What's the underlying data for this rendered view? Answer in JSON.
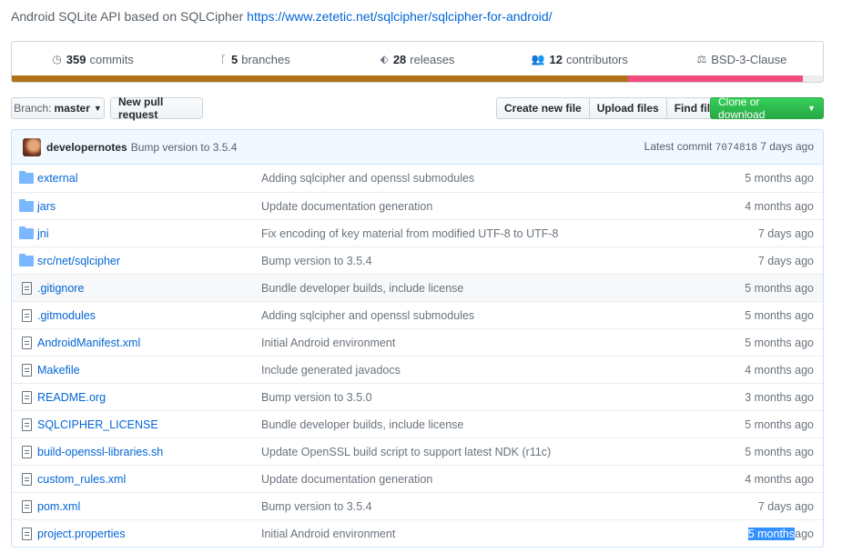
{
  "description": {
    "text": "Android SQLite API based on SQLCipher",
    "link": "https://www.zetetic.net/sqlcipher/sqlcipher-for-android/"
  },
  "summary": {
    "commits": {
      "num": "359",
      "label": "commits",
      "icon": "history-icon"
    },
    "branches": {
      "num": "5",
      "label": "branches",
      "icon": "branch-icon"
    },
    "releases": {
      "num": "28",
      "label": "releases",
      "icon": "tag-icon"
    },
    "contributors": {
      "num": "12",
      "label": "contributors",
      "icon": "people-icon"
    },
    "license": {
      "label": "BSD-3-Clause",
      "icon": "law-icon"
    }
  },
  "language_bar": [
    {
      "color": "#b07219",
      "fraction": 0.76
    },
    {
      "color": "#f34b7d",
      "fraction": 0.215
    },
    {
      "color": "#ededed",
      "fraction": 0.025
    }
  ],
  "toolbar": {
    "branch_prefix": "Branch:",
    "branch_name": "master",
    "new_pr": "New pull request",
    "create_file": "Create new file",
    "upload_files": "Upload files",
    "find_file": "Find file",
    "clone": "Clone or download"
  },
  "latest_commit": {
    "author": "developernotes",
    "message": "Bump version to 3.5.4",
    "prefix": "Latest commit",
    "sha": "7074818",
    "age": "7 days ago"
  },
  "files": [
    {
      "type": "dir",
      "name": "external",
      "message": "Adding sqlcipher and openssl submodules",
      "age": "5 months ago"
    },
    {
      "type": "dir",
      "name": "jars",
      "message": "Update documentation generation",
      "age": "4 months ago"
    },
    {
      "type": "dir",
      "name": "jni",
      "message": "Fix encoding of key material from modified UTF-8 to UTF-8",
      "age": "7 days ago"
    },
    {
      "type": "dir",
      "name": "src/net/sqlcipher",
      "message": "Bump version to 3.5.4",
      "age": "7 days ago"
    },
    {
      "type": "file",
      "name": ".gitignore",
      "message": "Bundle developer builds, include license",
      "age": "5 months ago",
      "highlight": true
    },
    {
      "type": "file",
      "name": ".gitmodules",
      "message": "Adding sqlcipher and openssl submodules",
      "age": "5 months ago"
    },
    {
      "type": "file",
      "name": "AndroidManifest.xml",
      "message": "Initial Android environment",
      "age": "5 months ago"
    },
    {
      "type": "file",
      "name": "Makefile",
      "message": "Include generated javadocs",
      "age": "4 months ago"
    },
    {
      "type": "file",
      "name": "README.org",
      "message": "Bump version to 3.5.0",
      "age": "3 months ago"
    },
    {
      "type": "file",
      "name": "SQLCIPHER_LICENSE",
      "message": "Bundle developer builds, include license",
      "age": "5 months ago"
    },
    {
      "type": "file",
      "name": "build-openssl-libraries.sh",
      "message": "Update OpenSSL build script to support latest NDK (r11c)",
      "age": "5 months ago"
    },
    {
      "type": "file",
      "name": "custom_rules.xml",
      "message": "Update documentation generation",
      "age": "4 months ago"
    },
    {
      "type": "file",
      "name": "pom.xml",
      "message": "Bump version to 3.5.4",
      "age": "7 days ago"
    },
    {
      "type": "file",
      "name": "project.properties",
      "message": "Initial Android environment",
      "age_selected": "5 months",
      "age_rest": "ago"
    }
  ]
}
